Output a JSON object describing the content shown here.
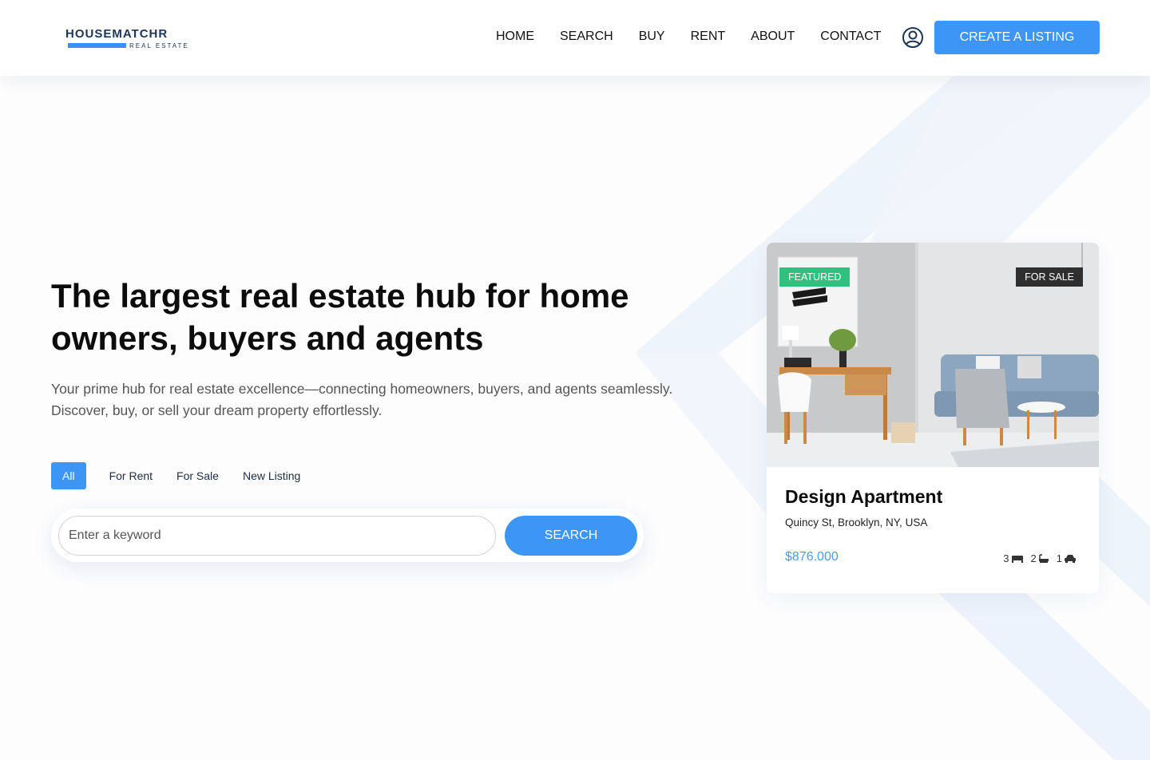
{
  "colors": {
    "accent": "#3d96f6",
    "brand_dark": "#1d3557",
    "featured_badge": "#2ec27e",
    "sale_badge": "#2f2f2f",
    "price": "#4a9bf5"
  },
  "header": {
    "logo": {
      "name": "HOUSEMATCHR",
      "tagline": "REAL ESTATE"
    },
    "nav": [
      "HOME",
      "SEARCH",
      "BUY",
      "RENT",
      "ABOUT",
      "CONTACT"
    ],
    "user_icon": "user-circle-icon",
    "create_button": "CREATE A LISTING"
  },
  "hero": {
    "title": "The largest real estate hub for home owners, buyers and agents",
    "subtitle": "Your prime hub for real estate excellence—connecting homeowners, buyers, and agents seamlessly. Discover, buy, or sell your dream property effortlessly.",
    "filters": [
      "All",
      "For Rent",
      "For Sale",
      "New Listing"
    ],
    "active_filter": "All",
    "search": {
      "placeholder": "Enter a keyword",
      "value": "",
      "button": "SEARCH"
    }
  },
  "listing": {
    "badge_featured": "FEATURED",
    "badge_status": "FOR SALE",
    "title": "Design Apartment",
    "address": "Quincy St, Brooklyn, NY, USA",
    "price": "$876.000",
    "features": [
      {
        "count": "3",
        "icon": "bed-icon"
      },
      {
        "count": "2",
        "icon": "bath-icon"
      },
      {
        "count": "1",
        "icon": "car-icon"
      }
    ]
  }
}
